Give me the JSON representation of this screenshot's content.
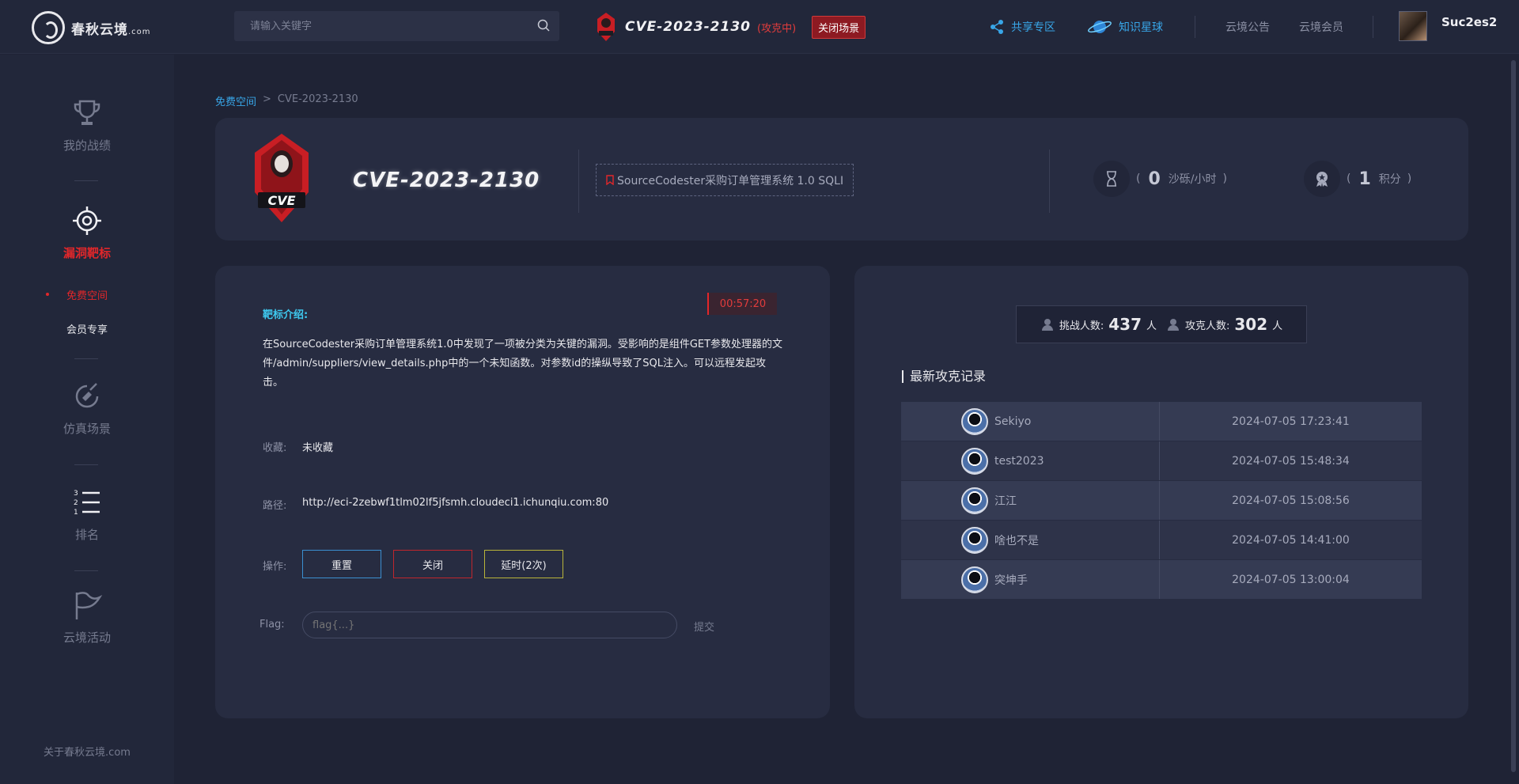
{
  "header": {
    "logo_text": "春秋云境",
    "logo_suffix": ".com",
    "search_placeholder": "请输入关键字",
    "scene_title": "CVE-2023-2130",
    "scene_status": "(攻克中)",
    "close_scene": "关闭场景",
    "nav": {
      "share": "共享专区",
      "knowledge": "知识星球",
      "notice": "云境公告",
      "member": "云境会员"
    },
    "username": "Suc2es2"
  },
  "sidebar": {
    "items": [
      {
        "label": "我的战绩",
        "icon": "trophy-icon"
      },
      {
        "label": "漏洞靶标",
        "icon": "target-icon"
      },
      {
        "label": "仿真场景",
        "icon": "hand-icon"
      },
      {
        "label": "排名",
        "icon": "ranking-list-icon"
      },
      {
        "label": "云境活动",
        "icon": "flag-icon"
      }
    ],
    "sub_items": [
      "免费空间",
      "会员专享"
    ],
    "footer": "关于春秋云境.com"
  },
  "breadcrumb": {
    "root": "免费空间",
    "sep": ">",
    "current": "CVE-2023-2130"
  },
  "target": {
    "title": "CVE-2023-2130",
    "vuln_name": "SourceCodester采购订单管理系统 1.0 SQLI",
    "sand": {
      "open": "(",
      "value": "0",
      "unit": "沙砾/小时",
      "close": ")"
    },
    "points": {
      "open": "(",
      "value": "1",
      "unit": "积分",
      "close": ")"
    }
  },
  "detail": {
    "timer": "00:57:20",
    "intro_label": "靶标介绍:",
    "intro_text": "在SourceCodester采购订单管理系统1.0中发现了一项被分类为关键的漏洞。受影响的是组件GET参数处理器的文件/admin/suppliers/view_details.php中的一个未知函数。对参数id的操纵导致了SQL注入。可以远程发起攻击。",
    "favorite_label": "收藏:",
    "favorite_value": "未收藏",
    "path_label": "路径:",
    "path_value": "http://eci-2zebwf1tlm02lf5jfsmh.cloudeci1.ichunqiu.com:80",
    "op_label": "操作:",
    "reset": "重置",
    "close": "关闭",
    "extend": "延时(2次)",
    "flag_label": "Flag:",
    "flag_placeholder": "flag{...}",
    "submit": "提交"
  },
  "records": {
    "challengers_label": "挑战人数:",
    "challengers_value": "437",
    "challengers_unit": "人",
    "solvers_label": "攻克人数:",
    "solvers_value": "302",
    "solvers_unit": "人",
    "title": "最新攻克记录",
    "rows": [
      {
        "user": "Sekiyo",
        "time": "2024-07-05 17:23:41"
      },
      {
        "user": "test2023",
        "time": "2024-07-05 15:48:34"
      },
      {
        "user": "江江",
        "time": "2024-07-05 15:08:56"
      },
      {
        "user": "啥也不是",
        "time": "2024-07-05 14:41:00"
      },
      {
        "user": "突坤手",
        "time": "2024-07-05 13:00:04"
      }
    ]
  },
  "colors": {
    "accent_red": "#e2272a",
    "accent_blue": "#38a6e8",
    "accent_cyan": "#3ec9ef",
    "bg": "#1f2335",
    "card": "#272c41"
  }
}
